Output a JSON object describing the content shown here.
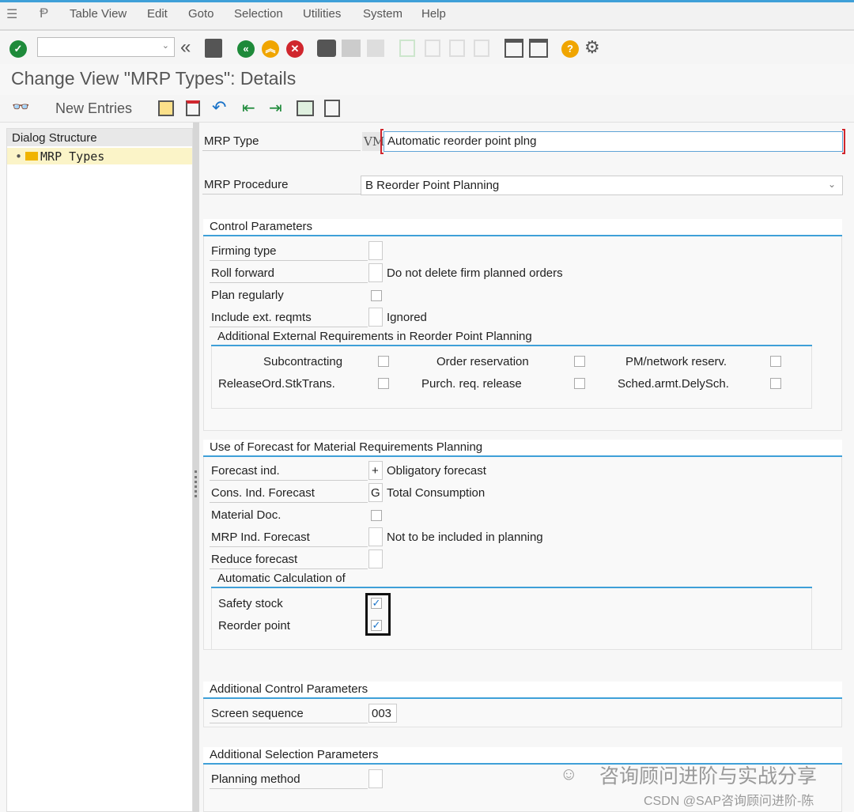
{
  "menu": {
    "items": [
      "Table View",
      "Edit",
      "Goto",
      "Selection",
      "Utilities",
      "System",
      "Help"
    ]
  },
  "toolbar": {
    "command_value": ""
  },
  "title": "Change View \"MRP Types\": Details",
  "app_toolbar": {
    "new_entries": "New Entries"
  },
  "dialog_structure": {
    "header": "Dialog Structure",
    "items": [
      "MRP Types"
    ]
  },
  "form": {
    "mrp_type_label": "MRP Type",
    "mrp_type_code": "VM",
    "mrp_type_desc": "Automatic reorder point plng",
    "mrp_procedure_label": "MRP Procedure",
    "mrp_procedure_value": "B Reorder Point Planning"
  },
  "control": {
    "title": "Control Parameters",
    "firming_type": "Firming type",
    "roll_forward": "Roll forward",
    "roll_forward_desc": "Do not delete firm planned orders",
    "plan_regularly": "Plan regularly",
    "include_ext": "Include ext. reqmts",
    "include_ext_desc": "Ignored",
    "ext_title": "Additional External Requirements in Reorder Point Planning",
    "subcontracting": "Subcontracting",
    "order_reservation": "Order reservation",
    "pm_network": "PM/network reserv.",
    "release_ord": "ReleaseOrd.StkTrans.",
    "purch_req": "Purch. req. release",
    "sched_armt": "Sched.armt.DelySch."
  },
  "forecast": {
    "title": "Use of Forecast for Material Requirements Planning",
    "forecast_ind": "Forecast ind.",
    "forecast_ind_value": "+",
    "forecast_ind_desc": "Obligatory forecast",
    "cons_ind": "Cons. Ind. Forecast",
    "cons_ind_value": "G",
    "cons_ind_desc": "Total Consumption",
    "material_doc": "Material Doc.",
    "mrp_ind": "MRP Ind. Forecast",
    "mrp_ind_desc": "Not to be included in planning",
    "reduce": "Reduce forecast",
    "auto_title": "Automatic Calculation of",
    "safety_stock": "Safety stock",
    "safety_stock_checked": true,
    "reorder_point": "Reorder point",
    "reorder_point_checked": true
  },
  "add_control": {
    "title": "Additional Control Parameters",
    "screen_seq": "Screen sequence",
    "screen_seq_value": "003"
  },
  "add_selection": {
    "title": "Additional Selection Parameters",
    "planning_method": "Planning method"
  },
  "watermark": {
    "line1": "咨询顾问进阶与实战分享",
    "line2": "CSDN @SAP咨询顾问进阶-陈"
  }
}
